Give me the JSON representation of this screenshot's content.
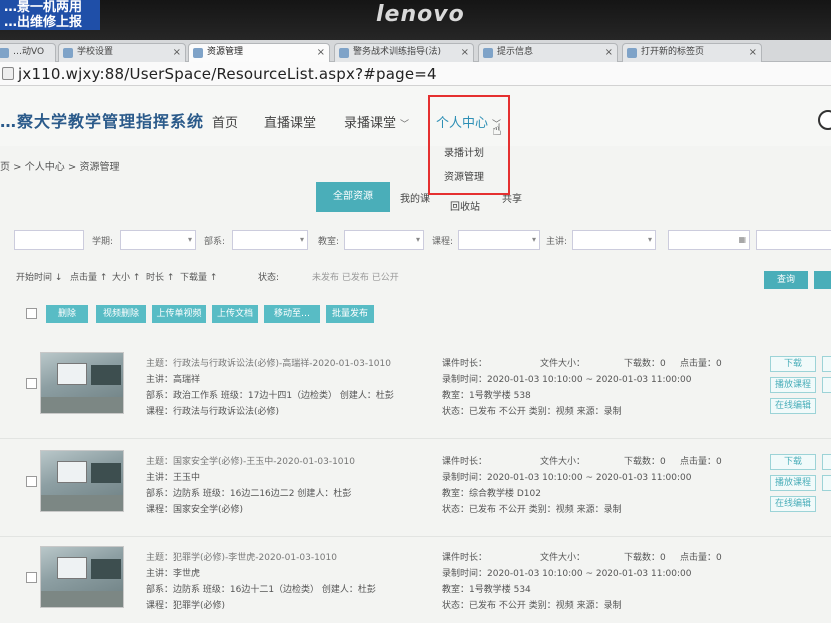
{
  "monitor": {
    "brand": "lenovo",
    "sticker_line1": "…景一机两用",
    "sticker_line2": "…出维修上报"
  },
  "browser": {
    "tabs": [
      {
        "label": "…动VO",
        "active": false
      },
      {
        "label": "学校设置",
        "active": false
      },
      {
        "label": "资源管理",
        "active": true
      },
      {
        "label": "警务战术训练指导(法)",
        "active": false
      },
      {
        "label": "提示信息",
        "active": false
      },
      {
        "label": "打开新的标签页",
        "active": false
      }
    ],
    "address": "jx110.wjxy:88/UserSpace/ResourceList.aspx?#page=4"
  },
  "header": {
    "site_title": "…察大学教学管理指挥系统",
    "nav": [
      {
        "label": "首页"
      },
      {
        "label": "直播课堂"
      },
      {
        "label": "录播课堂"
      },
      {
        "label": "个人中心"
      }
    ],
    "dropdown": [
      "录播计划",
      "资源管理"
    ]
  },
  "breadcrumb": "页 > 个人中心 > 资源管理",
  "categories": {
    "active": "全部资源",
    "links": [
      "我的课",
      "回收站",
      "共享"
    ]
  },
  "filters": {
    "labels": [
      "学期:",
      "部系:",
      "教室:",
      "课程:",
      "主讲:"
    ]
  },
  "sort": {
    "items": [
      "开始时间 ↓",
      "点击量 ↑",
      "大小 ↑",
      "时长 ↑",
      "下载量 ↑"
    ],
    "status_label": "状态:",
    "status_options": "未发布 已发布 已公开",
    "query_label": "查询"
  },
  "toolbar": {
    "buttons": [
      "删除",
      "视频删除",
      "上传单视频",
      "上传文档",
      "移动至…",
      "批量发布"
    ]
  },
  "resources": [
    {
      "title": "主题：行政法与行政诉讼法(必修)-高瑞祥-2020-01-03-1010",
      "lecturer": "主讲：高瑞祥",
      "dept": "部系：政治工作系   班级：17边十四1（边检类）   创建人：杜彭",
      "course": "课程：行政法与行政诉讼法(必修)",
      "duration": "课件时长：",
      "size": "文件大小：",
      "downloads": "下载数：0",
      "clicks": "点击量：0",
      "record_time": "录制时间：2020-01-03 10:10:00 ~ 2020-01-03 11:00:00",
      "room": "教室：1号教学楼 538",
      "status": "状态：已发布 不公开   类别：视频   来源：录制",
      "btn1": "下载",
      "btn2": "播放课程",
      "btn3": "在线编辑"
    },
    {
      "title": "主题：国家安全学(必修)-王玉中-2020-01-03-1010",
      "lecturer": "主讲：王玉中",
      "dept": "部系：边防系   班级：16边二16边二2   创建人：杜彭",
      "course": "课程：国家安全学(必修)",
      "duration": "课件时长：",
      "size": "文件大小：",
      "downloads": "下载数：0",
      "clicks": "点击量：0",
      "record_time": "录制时间：2020-01-03 10:10:00 ~ 2020-01-03 11:00:00",
      "room": "教室：综合教学楼 D102",
      "status": "状态：已发布 不公开   类别：视频   来源：录制",
      "btn1": "下载",
      "btn2": "播放课程",
      "btn3": "在线编辑"
    },
    {
      "title": "主题：犯罪学(必修)-李世虎-2020-01-03-1010",
      "lecturer": "主讲：李世虎",
      "dept": "部系：边防系   班级：16边十二1（边检类）   创建人：杜彭",
      "course": "课程：犯罪学(必修)",
      "duration": "课件时长：",
      "size": "文件大小：",
      "downloads": "下载数：0",
      "clicks": "点击量：0",
      "record_time": "录制时间：2020-01-03 10:10:00 ~ 2020-01-03 11:00:00",
      "room": "教室：1号教学楼 534",
      "status": "状态：已发布 不公开   类别：视频   来源：录制",
      "btn1": "下载",
      "btn2": "播放课程",
      "btn3": "在线编辑"
    }
  ],
  "colors": {
    "accent": "#4aaeb9",
    "highlight_box": "#e53030",
    "title_blue": "#2a5a8a"
  }
}
